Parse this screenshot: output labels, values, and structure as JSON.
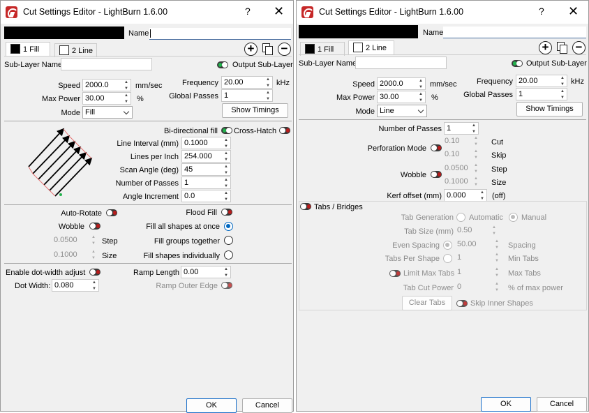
{
  "left": {
    "title": "Cut Settings Editor - LightBurn 1.6.00",
    "help": "?",
    "close": "✕",
    "name_label": "Name",
    "tabs": [
      {
        "label": "1 Fill",
        "color": "#000000"
      },
      {
        "label": "2 Line",
        "color": "#ffffff"
      }
    ],
    "sublayer_label": "Sub-Layer Name",
    "output_sublayer_label": "Output Sub-Layer",
    "speed_label": "Speed",
    "speed_value": "2000.0",
    "speed_unit": "mm/sec",
    "maxpower_label": "Max Power",
    "maxpower_value": "30.00",
    "maxpower_unit": "%",
    "mode_label": "Mode",
    "mode_value": "Fill",
    "frequency_label": "Frequency",
    "frequency_value": "20.00",
    "frequency_unit": "kHz",
    "globalpasses_label": "Global Passes",
    "globalpasses_value": "1",
    "show_timings": "Show Timings",
    "bidir_label": "Bi-directional fill",
    "crosshatch_label": "Cross-Hatch",
    "line_interval_label": "Line Interval (mm)",
    "line_interval_value": "0.1000",
    "lpi_label": "Lines per Inch",
    "lpi_value": "254.000",
    "scan_angle_label": "Scan Angle (deg)",
    "scan_angle_value": "45",
    "num_passes_label": "Number of Passes",
    "num_passes_value": "1",
    "angle_inc_label": "Angle Increment",
    "angle_inc_value": "0.0",
    "auto_rotate_label": "Auto-Rotate",
    "wobble_label": "Wobble",
    "wobble_step_value": "0.0500",
    "wobble_step_label": "Step",
    "wobble_size_value": "0.1000",
    "wobble_size_label": "Size",
    "flood_fill_label": "Flood Fill",
    "fill_all_label": "Fill all shapes at once",
    "fill_groups_label": "Fill groups together",
    "fill_indiv_label": "Fill shapes individually",
    "dotwidth_enable_label": "Enable dot-width adjust",
    "dotwidth_label": "Dot Width:",
    "dotwidth_value": "0.080",
    "ramp_length_label": "Ramp Length",
    "ramp_length_value": "0.00",
    "ramp_outer_label": "Ramp Outer Edge",
    "ok": "OK",
    "cancel": "Cancel"
  },
  "right": {
    "title": "Cut Settings Editor - LightBurn 1.6.00",
    "help": "?",
    "close": "✕",
    "name_label": "Name",
    "tabs": [
      {
        "label": "1 Fill",
        "color": "#000000"
      },
      {
        "label": "2 Line",
        "color": "#ffffff"
      }
    ],
    "sublayer_label": "Sub-Layer Name",
    "output_sublayer_label": "Output Sub-Layer",
    "speed_label": "Speed",
    "speed_value": "2000.0",
    "speed_unit": "mm/sec",
    "maxpower_label": "Max Power",
    "maxpower_value": "30.00",
    "maxpower_unit": "%",
    "mode_label": "Mode",
    "mode_value": "Line",
    "frequency_label": "Frequency",
    "frequency_value": "20.00",
    "frequency_unit": "kHz",
    "globalpasses_label": "Global Passes",
    "globalpasses_value": "1",
    "show_timings": "Show Timings",
    "num_passes_label": "Number of Passes",
    "num_passes_value": "1",
    "perforation_label": "Perforation Mode",
    "perf_cut_value": "0.10",
    "perf_cut_label": "Cut",
    "perf_skip_value": "0.10",
    "perf_skip_label": "Skip",
    "wobble_label": "Wobble",
    "wobble_step_value": "0.0500",
    "wobble_step_label": "Step",
    "wobble_size_value": "0.1000",
    "wobble_size_label": "Size",
    "kerf_label": "Kerf offset (mm)",
    "kerf_value": "0.000",
    "kerf_note": "(off)",
    "tabs_bridges_label": "Tabs / Bridges",
    "tab_gen_label": "Tab Generation",
    "tab_gen_auto": "Automatic",
    "tab_gen_manual": "Manual",
    "tab_size_label": "Tab Size (mm)",
    "tab_size_value": "0.50",
    "even_spacing_label": "Even Spacing",
    "even_spacing_value": "50.00",
    "spacing_label": "Spacing",
    "tabs_per_shape_label": "Tabs Per Shape",
    "tabs_per_shape_value": "1",
    "min_tabs_label": "Min Tabs",
    "limit_max_label": "Limit Max Tabs",
    "limit_max_value": "1",
    "max_tabs_label": "Max Tabs",
    "tab_cut_power_label": "Tab Cut Power",
    "tab_cut_power_value": "0",
    "tab_cut_power_unit": "% of max power",
    "clear_tabs": "Clear Tabs",
    "skip_inner_label": "Skip Inner Shapes",
    "ok": "OK",
    "cancel": "Cancel"
  }
}
